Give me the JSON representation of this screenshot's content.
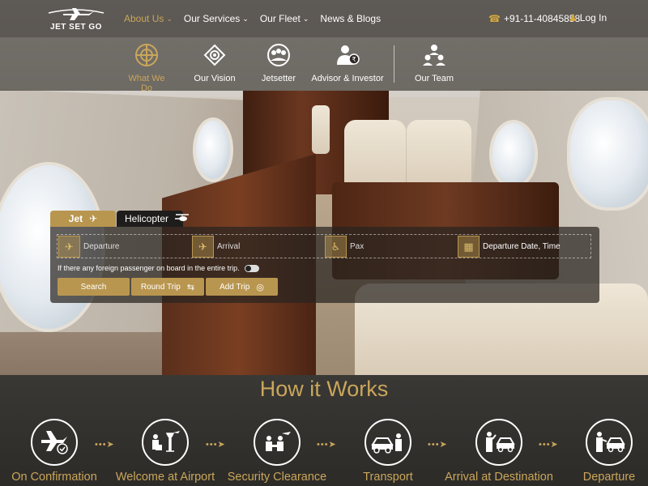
{
  "brand": {
    "name": "JET SET GO"
  },
  "nav": {
    "items": [
      {
        "label": "About Us",
        "has_dropdown": true,
        "active": true
      },
      {
        "label": "Our Services",
        "has_dropdown": true,
        "active": false
      },
      {
        "label": "Our Fleet",
        "has_dropdown": true,
        "active": false
      },
      {
        "label": "News & Blogs",
        "has_dropdown": false,
        "active": false
      }
    ],
    "phone": "+91-11-40845858",
    "login": "Log In"
  },
  "subnav": {
    "items": [
      {
        "label": "What We Do",
        "icon": "compass-icon",
        "active": true
      },
      {
        "label": "Our Vision",
        "icon": "vision-icon",
        "active": false
      },
      {
        "label": "Jetsetter",
        "icon": "people-icon",
        "active": false
      },
      {
        "label": "Advisor & Investor",
        "icon": "advisor-icon",
        "active": false
      },
      {
        "label": "Our Team",
        "icon": "team-icon",
        "active": false
      }
    ]
  },
  "booking": {
    "tabs": [
      {
        "label": "Jet",
        "icon": "plane-icon",
        "active": true
      },
      {
        "label": "Helicopter",
        "icon": "helicopter-icon",
        "active": false
      }
    ],
    "fields": {
      "departure": "Departure",
      "arrival": "Arrival",
      "pax": "Pax",
      "date_time": "Departure Date, Time"
    },
    "foreign_note": "If there any foreign passenger on board in the entire trip.",
    "buttons": {
      "search": "Search",
      "round_trip": "Round Trip",
      "add_trip": "Add Trip"
    }
  },
  "how_it_works": {
    "title": "How it Works",
    "steps": [
      {
        "label": "On Confirmation",
        "icon": "plane-check-icon"
      },
      {
        "label": "Welcome at Airport",
        "icon": "airport-icon"
      },
      {
        "label": "Security Clearance",
        "icon": "security-icon"
      },
      {
        "label": "Transport",
        "icon": "car-icon"
      },
      {
        "label": "Arrival at Destination",
        "icon": "arrival-icon"
      },
      {
        "label": "Departure",
        "icon": "departure-icon"
      }
    ]
  },
  "colors": {
    "accent": "#c9a65a",
    "button": "#b9964f",
    "dark_overlay": "#282420"
  }
}
